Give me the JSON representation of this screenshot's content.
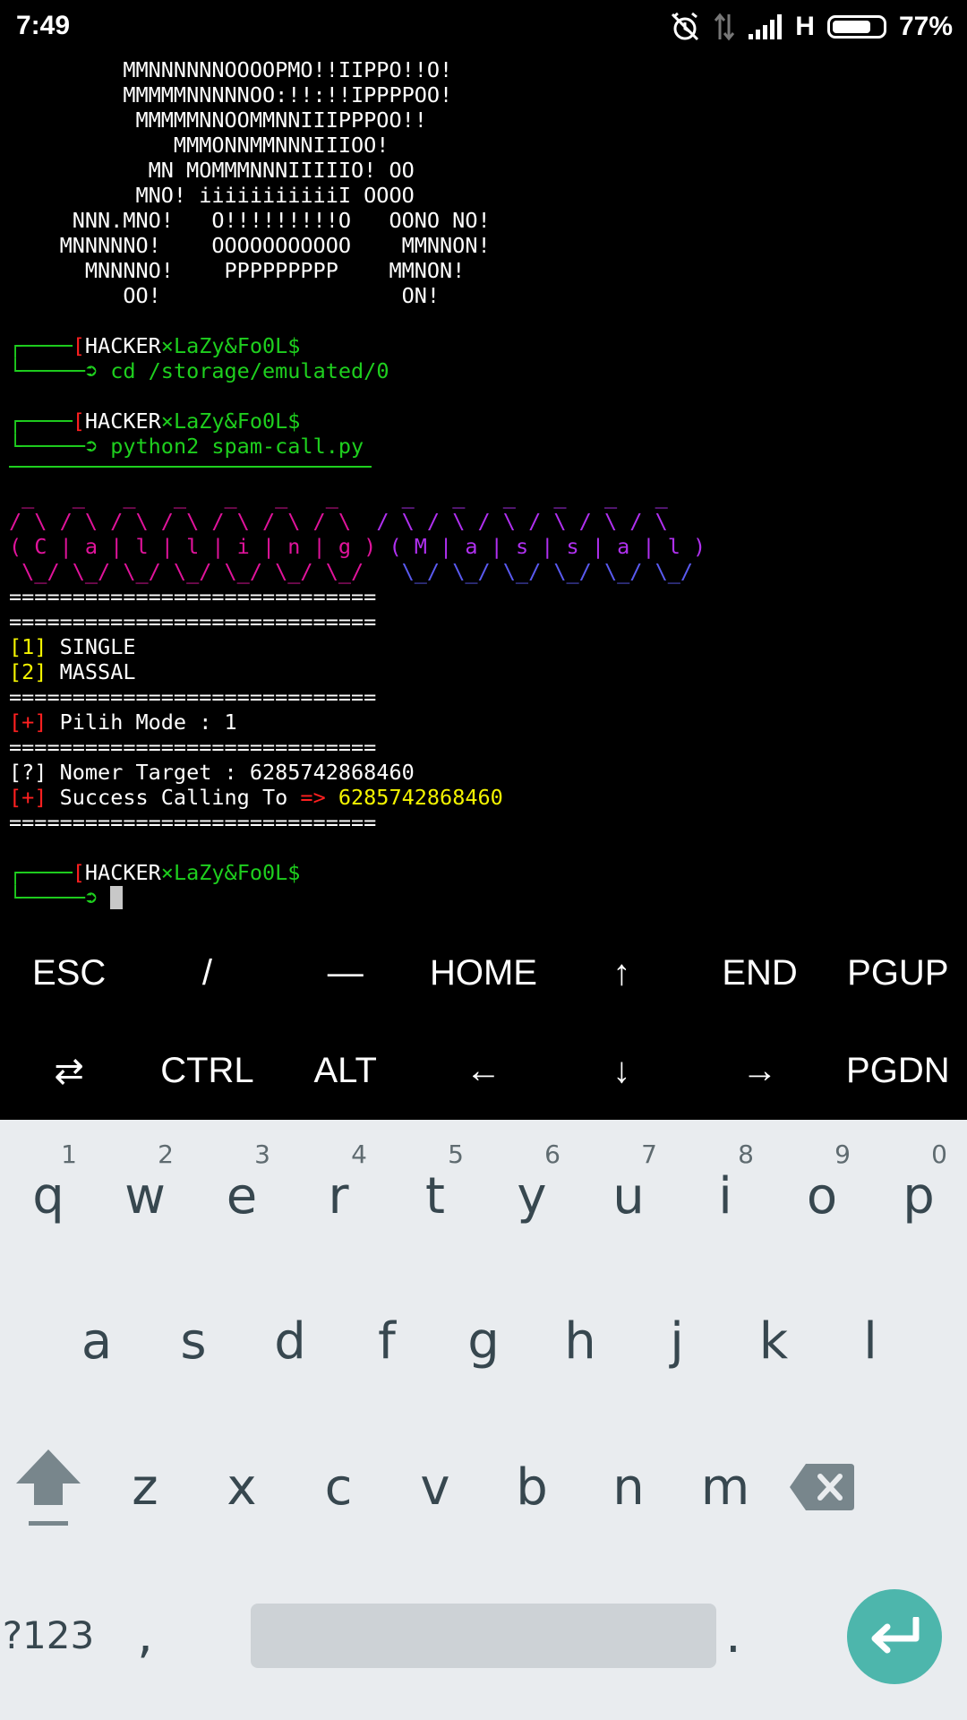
{
  "status": {
    "time": "7:49",
    "network_type": "H",
    "battery_percent": "77%",
    "battery_level": 0.77,
    "icons": [
      "alarm-off-icon",
      "data-arrows-icon",
      "signal-icon",
      "battery-icon"
    ]
  },
  "terminal": {
    "banner": [
      "         MMNNNNNNOOOOPMO!!IIPPO!!O!",
      "         MMMMMNNNNNOO:!!:!!IPPPPOO!",
      "          MMMMMNNOOMMNNIIIPPPOO!!",
      "             MMMONNMMNNNIIIOO!",
      "           MN MOMMMNNNIIIIIO! OO",
      "          MNO! iiiiiiiiiiiI OOOO",
      "     NNN.MNO!   O!!!!!!!!!O   OONO NO!",
      "    MNNNNNO!    OOOOOOOOOOO    MMNNON!",
      "      MNNNNO!    PPPPPPPPP    MMNON!",
      "         OO!                   ON!"
    ],
    "prompt_open": "[",
    "prompt_user": "HACKER",
    "prompt_sep": "×",
    "prompt_host": "LaZy&Fo0L$",
    "prompt_arrow": "➲",
    "cmd1": "cd /storage/emulated/0",
    "cmd2": "python2 spam-call.py",
    "ascii_calling": {
      "top": " _   _   _   _   _   _   _ ",
      "upper": "/ \\ / \\ / \\ / \\ / \\ / \\ / \\",
      "middle": "( C | a | l | l | i | n | g )",
      "bottom": " \\_/ \\_/ \\_/ \\_/ \\_/ \\_/ \\_/"
    },
    "ascii_massal": {
      "top": " _   _   _   _   _   _ ",
      "upper": "/ \\ / \\ / \\ / \\ / \\ / \\",
      "middle": "( M | a | s | s | a | l )",
      "bottom": " \\_/ \\_/ \\_/ \\_/ \\_/ \\_/"
    },
    "separator": "=============================",
    "option1_num": "[1]",
    "option1_label": " SINGLE",
    "option2_num": "[2]",
    "option2_label": " MASSAL",
    "plus_tag": "[+]",
    "pilih_mode": " Pilih Mode : 1",
    "question_tag": "[?]",
    "nomer_target": " Nomer Target : 6285742868460",
    "success_text": " Success Calling To ",
    "success_arrow": "=>",
    "success_number": " 6285742868460"
  },
  "extra_keys": {
    "row1": [
      "ESC",
      "/",
      "—",
      "HOME",
      "↑",
      "END",
      "PGUP"
    ],
    "row2": [
      "⇄",
      "CTRL",
      "ALT",
      "←",
      "↓",
      "→",
      "PGDN"
    ]
  },
  "keyboard": {
    "row1": [
      "q",
      "w",
      "e",
      "r",
      "t",
      "y",
      "u",
      "i",
      "o",
      "p"
    ],
    "row1_hints": [
      "1",
      "2",
      "3",
      "4",
      "5",
      "6",
      "7",
      "8",
      "9",
      "0"
    ],
    "row2": [
      "a",
      "s",
      "d",
      "f",
      "g",
      "h",
      "j",
      "k",
      "l"
    ],
    "row3": [
      "z",
      "x",
      "c",
      "v",
      "b",
      "n",
      "m"
    ],
    "symbols_key": "?123",
    "comma_key": ",",
    "period_key": ".",
    "accent_color": "#4db6ac"
  }
}
